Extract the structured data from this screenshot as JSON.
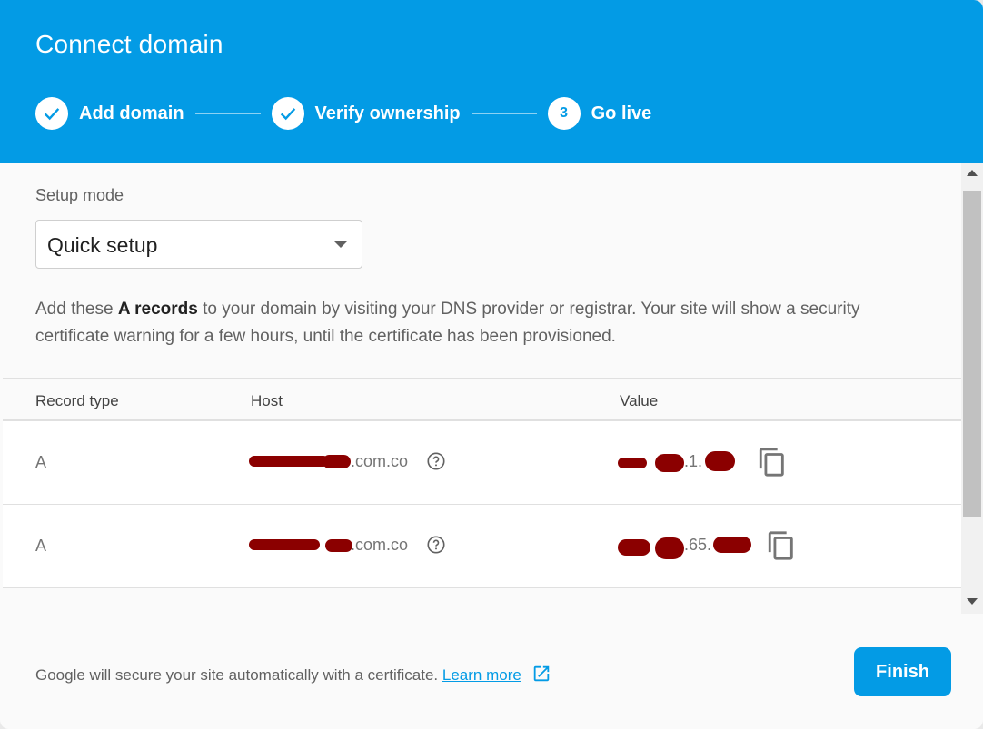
{
  "dialog": {
    "title": "Connect domain"
  },
  "stepper": {
    "steps": [
      {
        "label": "Add domain",
        "state": "done"
      },
      {
        "label": "Verify ownership",
        "state": "done"
      },
      {
        "label": "Go live",
        "state": "active",
        "number": "3"
      }
    ]
  },
  "setup": {
    "label": "Setup mode",
    "selected": "Quick setup"
  },
  "instructions": {
    "prefix": "Add these ",
    "bold": "A records",
    "suffix": " to your domain by visiting your DNS provider or registrar. Your site will show a security certificate warning for a few hours, until the certificate has been provisioned."
  },
  "table": {
    "headers": [
      "Record type",
      "Host",
      "Value"
    ],
    "rows": [
      {
        "type": "A",
        "host_visible": ".com.co",
        "value_visible": ".1."
      },
      {
        "type": "A",
        "host_visible": ".com.co",
        "value_visible": ".65."
      }
    ]
  },
  "footer": {
    "text": "Google will secure your site automatically with a certificate.",
    "link": "Learn more",
    "finish_label": "Finish"
  },
  "colors": {
    "primary": "#039be5",
    "redaction": "#8b0000"
  },
  "icons": [
    "check-icon",
    "help-circle-icon",
    "copy-icon",
    "external-link-icon",
    "dropdown-arrow-icon"
  ]
}
